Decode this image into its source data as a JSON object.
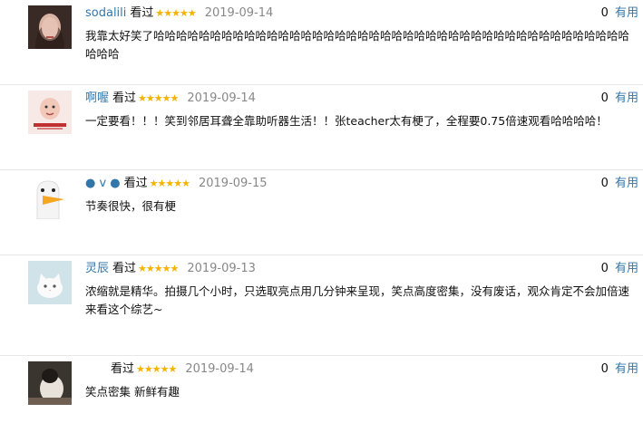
{
  "comments": [
    {
      "user": "sodalili",
      "status": "看过",
      "stars": "★★★★★",
      "date": "2019-09-14",
      "votes": "0",
      "useful_label": "有用",
      "text": "我靠太好笑了哈哈哈哈哈哈哈哈哈哈哈哈哈哈哈哈哈哈哈哈哈哈哈哈哈哈哈哈哈哈哈哈哈哈哈哈哈哈哈哈哈哈哈哈哈"
    },
    {
      "user": "啊喔",
      "status": "看过",
      "stars": "★★★★★",
      "date": "2019-09-14",
      "votes": "0",
      "useful_label": "有用",
      "text": "一定要看！！！笑到邻居耳聋全靠助听器生活！！张teacher太有梗了，全程要0.75倍速观看哈哈哈哈！"
    },
    {
      "user": "● v ●",
      "status": "看过",
      "stars": "★★★★★",
      "date": "2019-09-15",
      "votes": "0",
      "useful_label": "有用",
      "text": "节奏很快，很有梗"
    },
    {
      "user": "灵辰",
      "status": "看过",
      "stars": "★★★★★",
      "date": "2019-09-13",
      "votes": "0",
      "useful_label": "有用",
      "text": "浓缩就是精华。拍摄几个小时，只选取亮点用几分钟来呈现，笑点高度密集，没有废话，观众肯定不会加倍速来看这个综艺~"
    },
    {
      "user": "",
      "status": "看过",
      "stars": "★★★★★",
      "date": "2019-09-14",
      "votes": "0",
      "useful_label": "有用",
      "text": "笑点密集 新鲜有趣"
    }
  ],
  "colors": {
    "link": "#3377aa",
    "star": "#f4b300",
    "date": "#888888",
    "divider": "#e8e8e8"
  },
  "avatars": [
    "user-photo-portrait",
    "baby-photo",
    "goose-cartoon",
    "white-kitten-photo",
    "dark-photo"
  ]
}
